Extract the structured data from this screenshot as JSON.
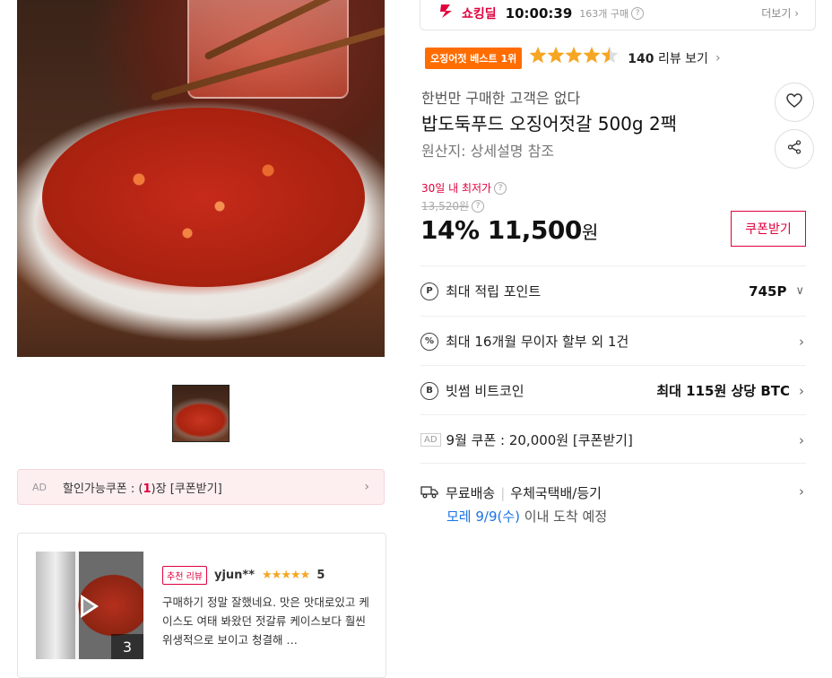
{
  "product": {
    "subtitle": "한번만 구매한 고객은 없다",
    "title": "밥도둑푸드 오징어젓갈 500g 2팩",
    "origin": "원산지:  상세설명 참조",
    "best_badge": "오징어젓 베스트 1위",
    "rating_stars": 4.5,
    "review_count": "140",
    "review_label": "리뷰 보기"
  },
  "shocking_deal": {
    "brand": "쇼킹딜",
    "timer": "10:00:39",
    "sold": "163개 구매",
    "more": "더보기"
  },
  "price": {
    "lowest_label": "30일 내 최저가",
    "original": "13,520원",
    "discount": "14%",
    "sale_price": "11,500",
    "currency": "원",
    "coupon_button": "쿠폰받기"
  },
  "benefits": [
    {
      "icon": "P",
      "label": "최대 적립 포인트",
      "value": "745P",
      "chevron": "down"
    },
    {
      "icon": "%",
      "label": "최대 16개월 무이자 할부 외 1건",
      "value": "",
      "chevron": "right"
    },
    {
      "icon": "B",
      "label": "빗썸 비트코인",
      "value": "최대 115원 상당 BTC",
      "chevron": "right"
    },
    {
      "icon": "AD",
      "label": "9월 쿠폰 : 20,000원 [쿠폰받기]",
      "value": "",
      "chevron": "right"
    }
  ],
  "shipping": {
    "free": "무료배송",
    "method": "우체국택배/등기",
    "eta_date": "모레 9/9(수)",
    "eta_suffix": " 이내 도착 예정"
  },
  "left_coupon": {
    "ad": "AD",
    "prefix": "할인가능쿠폰 : (",
    "count": "1",
    "suffix": ")장 [쿠폰받기]"
  },
  "review": {
    "badge": "추천 리뷰",
    "user": "yjun**",
    "stars": "★★★★★",
    "score": "5",
    "text": "구매하기 정말 잘했네요. 맛은 맛대로있고 케이스도 여태 봐왔던 젓갈류 케이스보다 훨씬 위생적으로 보이고 청결해 …",
    "media_count": "3"
  },
  "colors": {
    "accent": "#e0003c",
    "best_badge": "#ff6d00",
    "star": "#f5a623",
    "eta": "#1a73e8"
  }
}
